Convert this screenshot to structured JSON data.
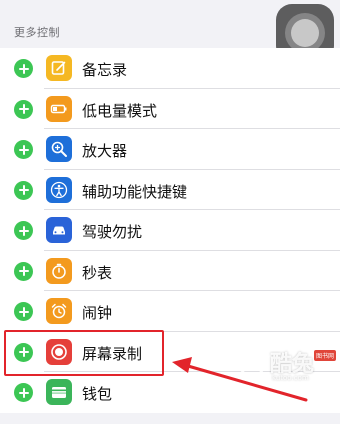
{
  "section": {
    "title": "更多控制"
  },
  "controls": [
    {
      "label": "备忘录",
      "icon": "notes-icon",
      "color": "#f5b823"
    },
    {
      "label": "低电量模式",
      "icon": "battery-icon",
      "color": "#f39a1e"
    },
    {
      "label": "放大器",
      "icon": "magnifier-icon",
      "color": "#1e6fd9"
    },
    {
      "label": "辅助功能快捷键",
      "icon": "accessibility-icon",
      "color": "#1e6fd9"
    },
    {
      "label": "驾驶勿扰",
      "icon": "car-icon",
      "color": "#2a63d8"
    },
    {
      "label": "秒表",
      "icon": "stopwatch-icon",
      "color": "#f39a1e"
    },
    {
      "label": "闹钟",
      "icon": "alarm-icon",
      "color": "#f39a1e"
    },
    {
      "label": "屏幕录制",
      "icon": "screen-record-icon",
      "color": "#e53f3a"
    },
    {
      "label": "钱包",
      "icon": "wallet-icon",
      "color": "#3bb55a"
    }
  ],
  "colors": {
    "add": "#3cc654",
    "highlight": "#e2242b"
  },
  "watermark": {
    "text": "酷兔",
    "badge": "图书网",
    "url": "kutoo.com"
  }
}
